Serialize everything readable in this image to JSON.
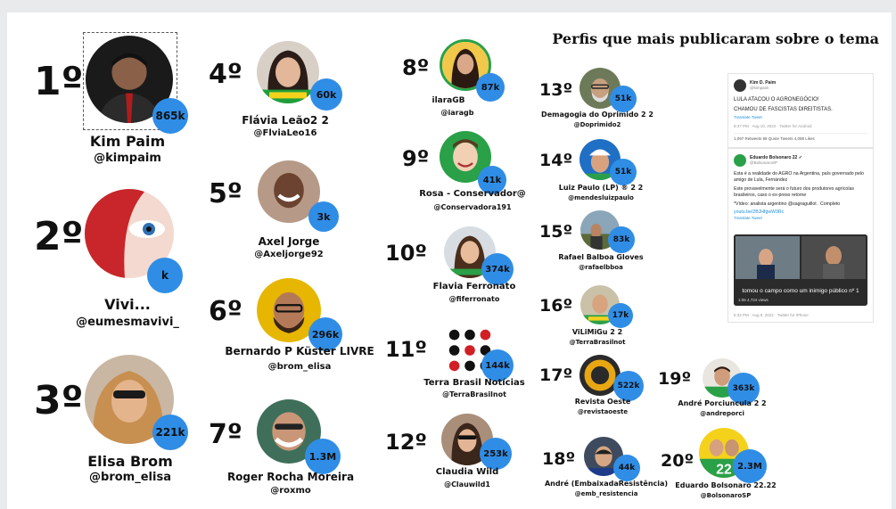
{
  "title": "Perfis que mais publicaram sobre o tema",
  "profiles": [
    {
      "rank": "1º",
      "name": "Kim Paim",
      "handle": "@kimpaim",
      "count": "865k"
    },
    {
      "rank": "2º",
      "name": "Vivi...",
      "handle": "@eumesmavivi_",
      "count": "k"
    },
    {
      "rank": "3º",
      "name": "Elisa Brom",
      "handle": "@brom_elisa",
      "count": "221k"
    },
    {
      "rank": "4º",
      "name": "Flávia Leão2  2",
      "handle": "@FlviaLeo16",
      "count": "60k"
    },
    {
      "rank": "5º",
      "name": "Axel Jorge",
      "handle": "@Axeljorge92",
      "count": "3k"
    },
    {
      "rank": "6º",
      "name": "Bernardo P Küster LIVRE",
      "handle": "@brom_elisa",
      "count": "296k"
    },
    {
      "rank": "7º",
      "name": "Roger Rocha Moreira",
      "handle": "@roxmo",
      "count": "1.3M"
    },
    {
      "rank": "8º",
      "name": "ilaraGB   ",
      "handle": "@iaragb",
      "count": "87k"
    },
    {
      "rank": "9º",
      "name": "Rosa - Conservador@",
      "handle": "@Conservadora191",
      "count": "41k"
    },
    {
      "rank": "10º",
      "name": "Flavia Ferronato",
      "handle": "@fiferronato",
      "count": "374k"
    },
    {
      "rank": "11º",
      "name": "Terra Brasil Notícias",
      "handle": "@TerraBrasilnot",
      "count": "144k"
    },
    {
      "rank": "12º",
      "name": "Claudia Wild",
      "handle": "@Clauwild1",
      "count": "253k"
    },
    {
      "rank": "13º",
      "name": "Demagogia do Oprimido 2  2",
      "handle": "@Doprimido2",
      "count": "51k"
    },
    {
      "rank": "14º",
      "name": "Luiz Paulo (LP) ®      2  2",
      "handle": "@mendesluizpaulo",
      "count": "51k"
    },
    {
      "rank": "15º",
      "name": "Rafael Balboa Gloves",
      "handle": "@rafaelbboa",
      "count": "83k"
    },
    {
      "rank": "16º",
      "name": "ViLiMiGu      2  2",
      "handle": "@TerraBrasilnot",
      "count": "17k"
    },
    {
      "rank": "17º",
      "name": "Revista Oeste",
      "handle": "@revistaoeste",
      "count": "522k"
    },
    {
      "rank": "18º",
      "name": "André (EmbaixadaResistência)",
      "handle": "@emb_resistencia",
      "count": "44k"
    },
    {
      "rank": "19º",
      "name": "André Porciuncula 2  2",
      "handle": "@andreporci",
      "count": "363k"
    },
    {
      "rank": "20º",
      "name": "Eduardo Bolsonaro 22.22",
      "handle": "@BolsonaroSP",
      "count": "2.3M"
    }
  ],
  "tweet1": {
    "author": "Kim D. Paim",
    "author_handle": "@kimpaim",
    "line1": "LULA ATACOU O AGRONEGÓCIO!",
    "line2": "CHAMOU DE FASCISTAS DIREITISTAS.",
    "translate": "Translate Tweet",
    "meta": "8:37 PM · Aug 10, 2022 · Twitter for Android",
    "stats": "1,097 Retweets    98 Quote Tweets    4,098 Likes"
  },
  "tweet2": {
    "author": "Eduardo Bolsonaro 22 ✓",
    "author_handle": "@BolsonaroSP",
    "p1": "Esta é a realidade do AGRO na Argentina, país governado pelo amigo de Lula, Fernández",
    "p2": "Este provavelmente será o futuro dos produtores agrícolas brasileiros, caso o ex-preso retorne",
    "p3": "*Vídeo: analista argentino @sagraguillot . Completo",
    "link": "youtu.be/2BJHfgwW3Rc",
    "translate": "Translate Tweet",
    "video_caption": "tomou o campo como um inimigo público nº 1",
    "video_time": "1:06   4,724 views",
    "meta": "6:32 PM · Aug 9, 2022 · Twitter for iPhone"
  },
  "colors": {
    "badge": "#2f8de6",
    "background": "#ffffff"
  }
}
